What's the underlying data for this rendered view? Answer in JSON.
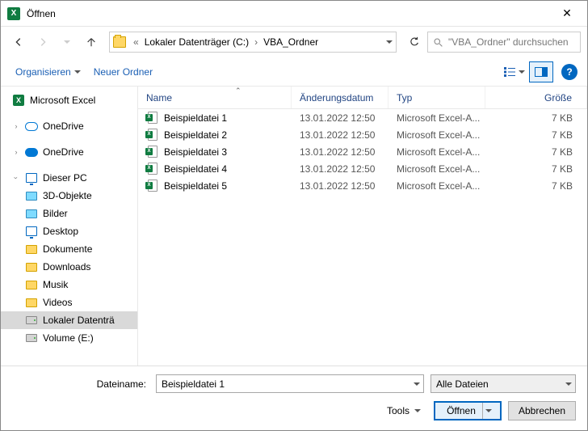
{
  "window": {
    "title": "Öffnen"
  },
  "address": {
    "chevL": "«",
    "crumb1": "Lokaler Datenträger (C:)",
    "crumb2": "VBA_Ordner"
  },
  "search": {
    "placeholder": "\"VBA_Ordner\" durchsuchen"
  },
  "toolbar": {
    "organize": "Organisieren",
    "newFolder": "Neuer Ordner",
    "help": "?"
  },
  "sidebar": {
    "excel": "Microsoft Excel",
    "onedrive1": "OneDrive",
    "onedrive2": "OneDrive",
    "thispc": "Dieser PC",
    "items": [
      "3D-Objekte",
      "Bilder",
      "Desktop",
      "Dokumente",
      "Downloads",
      "Musik",
      "Videos",
      "Lokaler Datenträ",
      "Volume (E:)"
    ]
  },
  "columns": {
    "name": "Name",
    "date": "Änderungsdatum",
    "type": "Typ",
    "size": "Größe"
  },
  "files": [
    {
      "name": "Beispieldatei 1",
      "date": "13.01.2022 12:50",
      "type": "Microsoft Excel-A...",
      "size": "7 KB"
    },
    {
      "name": "Beispieldatei 2",
      "date": "13.01.2022 12:50",
      "type": "Microsoft Excel-A...",
      "size": "7 KB"
    },
    {
      "name": "Beispieldatei 3",
      "date": "13.01.2022 12:50",
      "type": "Microsoft Excel-A...",
      "size": "7 KB"
    },
    {
      "name": "Beispieldatei 4",
      "date": "13.01.2022 12:50",
      "type": "Microsoft Excel-A...",
      "size": "7 KB"
    },
    {
      "name": "Beispieldatei 5",
      "date": "13.01.2022 12:50",
      "type": "Microsoft Excel-A...",
      "size": "7 KB"
    }
  ],
  "footer": {
    "filenameLabel": "Dateiname:",
    "filenameValue": "Beispieldatei 1",
    "filter": "Alle Dateien",
    "tools": "Tools",
    "open": "Öffnen",
    "cancel": "Abbrechen"
  }
}
